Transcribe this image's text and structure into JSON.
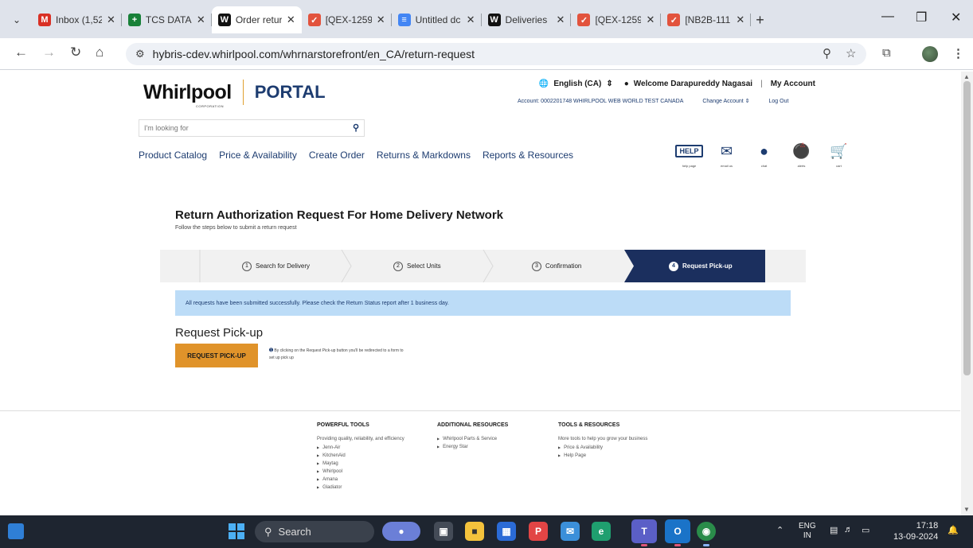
{
  "browser": {
    "tabs": [
      {
        "label": "Inbox (1,52",
        "favicon": "M",
        "color": "#d93025",
        "active": false
      },
      {
        "label": "TCS DATA",
        "favicon": "+",
        "color": "#188038",
        "active": false
      },
      {
        "label": "Order retur",
        "favicon": "W",
        "color": "#111111",
        "active": true
      },
      {
        "label": "[QEX-1259",
        "favicon": "✓",
        "color": "#e2533d",
        "active": false
      },
      {
        "label": "Untitled dc",
        "favicon": "≡",
        "color": "#4285f4",
        "active": false
      },
      {
        "label": "Deliveries",
        "favicon": "W",
        "color": "#111111",
        "active": false
      },
      {
        "label": "[QEX-1259",
        "favicon": "✓",
        "color": "#e2533d",
        "active": false
      },
      {
        "label": "[NB2B-111",
        "favicon": "✓",
        "color": "#e2533d",
        "active": false
      }
    ],
    "url": "hybris-cdev.whirlpool.com/whrnarstorefront/en_CA/return-request"
  },
  "header": {
    "logo_text": "Whirlpool",
    "logo_sub": "CORPORATION",
    "portal_text": "PORTAL",
    "language": "English (CA)",
    "welcome": "Welcome Darapureddy Nagasai",
    "my_account": "My Account",
    "account_line": "Account: 0002201748  WHIRLPOOL WEB WORLD TEST CANADA",
    "change_account": "Change Account",
    "logout": "Log Out",
    "search_placeholder": "I'm looking for"
  },
  "main_nav": [
    "Product Catalog",
    "Price & Availability",
    "Create Order",
    "Returns & Markdowns",
    "Reports & Resources"
  ],
  "utility_icons": [
    {
      "label": "help page",
      "icon": "help-icon"
    },
    {
      "label": "email us",
      "icon": "envelope-icon"
    },
    {
      "label": "chat",
      "icon": "chat-icon"
    },
    {
      "label": "alerts",
      "icon": "bell-icon"
    },
    {
      "label": "cart",
      "icon": "cart-icon"
    }
  ],
  "page": {
    "title": "Return Authorization Request For Home Delivery Network",
    "subtitle": "Follow the steps below to submit a return request",
    "steps": [
      {
        "num": "1",
        "label": "Search for Delivery"
      },
      {
        "num": "2",
        "label": "Select Units"
      },
      {
        "num": "3",
        "label": "Confirmation"
      },
      {
        "num": "4",
        "label": "Request Pick-up"
      }
    ],
    "success_message": "All requests have been submitted successfully. Please check the Return Status report after 1 business day.",
    "pickup_title": "Request Pick-up",
    "pickup_button": "REQUEST PICK-UP",
    "pickup_note": "By clicking on the Request Pick-up button you'll be redirected to a form to set up pick up"
  },
  "footer": {
    "col1": {
      "title": "POWERFUL TOOLS",
      "text": "Providing quality, reliability, and efficiency",
      "items": [
        "Jenn-Air",
        "KitchenAid",
        "Maytag",
        "Whirlpool",
        "Amana",
        "Gladiator"
      ]
    },
    "col2": {
      "title": "ADDITIONAL RESOURCES",
      "items": [
        "Whirlpool Parts & Service",
        "Energy Star"
      ]
    },
    "col3": {
      "title": "TOOLS & RESOURCES",
      "text": "More tools to help you grow your business",
      "items": [
        "Price & Availability",
        "Help Page"
      ]
    }
  },
  "taskbar": {
    "search_label": "Search",
    "lang": "ENG",
    "region": "IN",
    "time": "17:18",
    "date": "13-09-2024"
  }
}
